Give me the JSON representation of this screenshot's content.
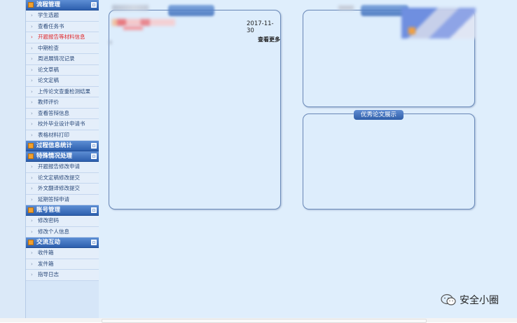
{
  "sidebar": {
    "sections": [
      {
        "title": "流程管理",
        "items": [
          {
            "label": "学生选题",
            "active": false
          },
          {
            "label": "查看任务书",
            "active": false
          },
          {
            "label": "开题报告等材料信息",
            "active": true
          },
          {
            "label": "中期检查",
            "active": false
          },
          {
            "label": "周进展情况记录",
            "active": false
          },
          {
            "label": "论文草稿",
            "active": false
          },
          {
            "label": "论文定稿",
            "active": false
          },
          {
            "label": "上传论文查重检测结果",
            "active": false
          },
          {
            "label": "教师评价",
            "active": false
          },
          {
            "label": "查看答辩信息",
            "active": false
          },
          {
            "label": "校外毕业设计申请书",
            "active": false
          },
          {
            "label": "表格材料打印",
            "active": false
          }
        ]
      },
      {
        "title": "过程信息统计",
        "items": []
      },
      {
        "title": "特殊情况处理",
        "items": [
          {
            "label": "开题报告修改申请",
            "active": false
          },
          {
            "label": "论文定稿修改提交",
            "active": false
          },
          {
            "label": "外文翻译修改提交",
            "active": false
          },
          {
            "label": "延期答辩申请",
            "active": false
          }
        ]
      },
      {
        "title": "账号管理",
        "items": [
          {
            "label": "修改密码",
            "active": false
          },
          {
            "label": "修改个人信息",
            "active": false
          }
        ]
      },
      {
        "title": "交流互动",
        "items": [
          {
            "label": "收件箱",
            "active": false
          },
          {
            "label": "发件箱",
            "active": false
          },
          {
            "label": "指导日志",
            "active": false
          }
        ]
      }
    ]
  },
  "panels": {
    "notice": {
      "date": "2017-11-30",
      "more": "查看更多"
    },
    "excellent": {
      "title": "优秀论文展示"
    }
  },
  "watermark": {
    "text": "安全小圈",
    "icon": "wechat-icon"
  },
  "colors": {
    "header": "#2d5fae",
    "active": "#e0262a",
    "background": "#dfeefc"
  }
}
